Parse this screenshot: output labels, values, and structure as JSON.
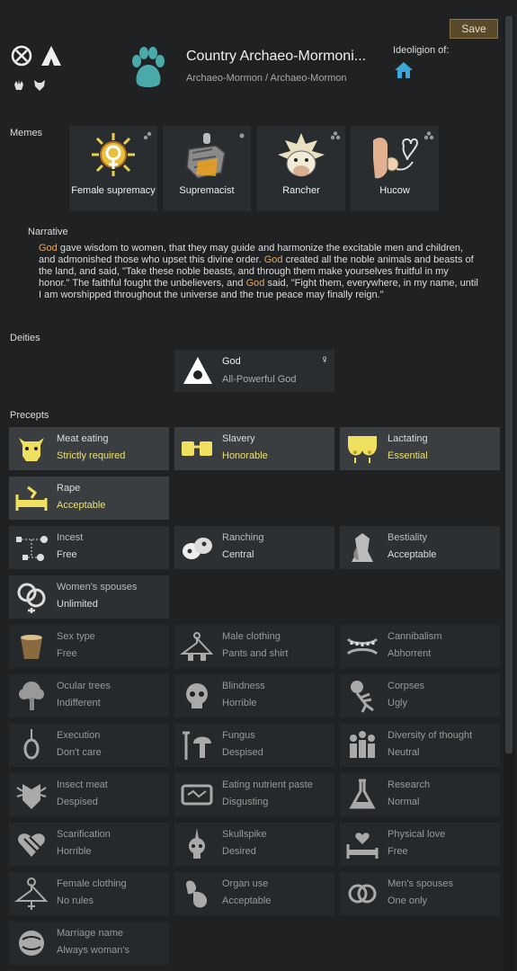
{
  "header": {
    "save_label": "Save",
    "title": "Country Archaeo-Mormoni...",
    "subtitle": "Archaeo-Mormon / Archaeo-Mormon",
    "ideoligion_label": "Ideoligion of:"
  },
  "memes_label": "Memes",
  "memes": [
    {
      "label": "Female supremacy",
      "icon": "female-sun-icon"
    },
    {
      "label": "Supremacist",
      "icon": "fist-icon"
    },
    {
      "label": "Rancher",
      "icon": "cow-icon"
    },
    {
      "label": "Hucow",
      "icon": "hucow-icon"
    }
  ],
  "narrative": {
    "title": "Narrative",
    "segments": [
      {
        "text": "God",
        "god": true
      },
      {
        "text": " gave wisdom to women, that they may guide and harmonize the excitable men and children, and admonished those who upset this divine order. "
      },
      {
        "text": "God",
        "god": true
      },
      {
        "text": " created all the noble animals and beasts of the land, and said, \"Take these noble beasts, and through them make yourselves fruitful in my honor.\" The faithful fought the unbelievers, and "
      },
      {
        "text": "God",
        "god": true
      },
      {
        "text": " said, \"Fight them, everywhere, in my name, until I am worshipped throughout the universe and the true peace may finally reign.\""
      }
    ]
  },
  "deities_label": "Deities",
  "deity": {
    "name": "God",
    "title": "All-Powerful God",
    "gender_symbol": "♀"
  },
  "precepts_label": "Precepts",
  "precepts": [
    {
      "name": "Meat eating",
      "value": "Strictly required",
      "style": "hi",
      "gold": true,
      "icon": "meat-cow-icon"
    },
    {
      "name": "Slavery",
      "value": "Honorable",
      "style": "hi",
      "gold": true,
      "icon": "shackles-icon"
    },
    {
      "name": "Lactating",
      "value": "Essential",
      "style": "hi",
      "gold": true,
      "icon": "breasts-icon"
    },
    {
      "name": "Rape",
      "value": "Acceptable",
      "style": "hi",
      "gold": true,
      "icon": "bed-icon"
    },
    {
      "name": "Incest",
      "value": "Free",
      "style": "",
      "icon": "family-tree-icon"
    },
    {
      "name": "Ranching",
      "value": "Central",
      "style": "",
      "icon": "cows-icon"
    },
    {
      "name": "Bestiality",
      "value": "Acceptable",
      "style": "",
      "icon": "beast-icon"
    },
    {
      "name": "Women's spouses",
      "value": "Unlimited",
      "style": "",
      "icon": "rings-female-icon"
    },
    {
      "name": "Sex type",
      "value": "Free",
      "style": "dim",
      "icon": "bucket-icon"
    },
    {
      "name": "Male clothing",
      "value": "Pants and shirt",
      "style": "dim",
      "icon": "hanger-icon"
    },
    {
      "name": "Cannibalism",
      "value": "Abhorrent",
      "style": "dim",
      "icon": "teeth-icon"
    },
    {
      "name": "Ocular trees",
      "value": "Indifferent",
      "style": "dim",
      "icon": "tree-icon"
    },
    {
      "name": "Blindness",
      "value": "Horrible",
      "style": "dim",
      "icon": "skull-icon"
    },
    {
      "name": "Corpses",
      "value": "Ugly",
      "style": "dim",
      "icon": "skeleton-icon"
    },
    {
      "name": "Execution",
      "value": "Don't care",
      "style": "dim",
      "icon": "noose-icon"
    },
    {
      "name": "Fungus",
      "value": "Despised",
      "style": "dim",
      "icon": "mushroom-icon"
    },
    {
      "name": "Diversity of thought",
      "value": "Neutral",
      "style": "dim",
      "icon": "people-icon"
    },
    {
      "name": "Insect meat",
      "value": "Despised",
      "style": "dim",
      "icon": "insect-icon"
    },
    {
      "name": "Eating nutrient paste",
      "value": "Disgusting",
      "style": "dim",
      "icon": "paste-icon"
    },
    {
      "name": "Research",
      "value": "Normal",
      "style": "dim",
      "icon": "flask-icon"
    },
    {
      "name": "Scarification",
      "value": "Horrible",
      "style": "dim",
      "icon": "scar-heart-icon"
    },
    {
      "name": "Skullspike",
      "value": "Desired",
      "style": "dim",
      "icon": "skullspike-icon"
    },
    {
      "name": "Physical love",
      "value": "Free",
      "style": "dim",
      "icon": "love-bed-icon"
    },
    {
      "name": "Female clothing",
      "value": "No rules",
      "style": "dim",
      "icon": "hanger-female-icon"
    },
    {
      "name": "Organ use",
      "value": "Acceptable",
      "style": "dim",
      "icon": "organ-icon"
    },
    {
      "name": "Men's spouses",
      "value": "One only",
      "style": "dim",
      "icon": "rings-icon"
    },
    {
      "name": "Marriage name",
      "value": "Always woman's",
      "style": "dim",
      "icon": "marriage-name-icon"
    }
  ]
}
